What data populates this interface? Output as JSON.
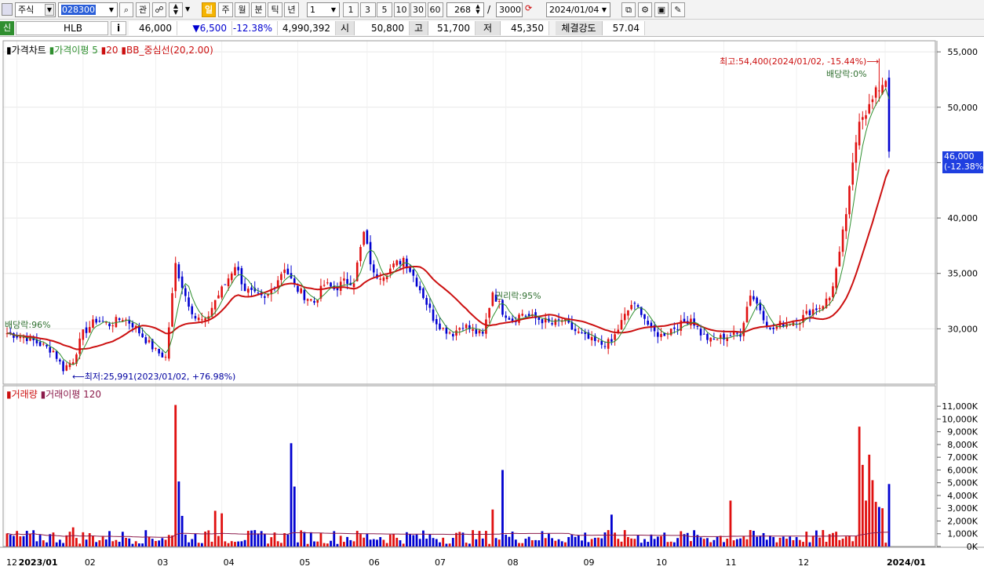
{
  "toolbar": {
    "market": "주식",
    "code": "028300",
    "search_icon": "search-icon",
    "interest_label": "관",
    "period_active": "일",
    "periods": [
      "주",
      "월",
      "분",
      "틱",
      "년"
    ],
    "interval_value": "1",
    "interval_presets": [
      "1",
      "3",
      "5",
      "10",
      "30",
      "60"
    ],
    "count_value": "268",
    "count_total": "3000",
    "date_value": "2024/01/04"
  },
  "infobar": {
    "flag": "신",
    "name": "HLB",
    "info_button": "i",
    "price": "46,000",
    "change": "▼6,500",
    "change_pct": "-12.38%",
    "volume": "4,990,392",
    "open_label": "시",
    "open": "50,800",
    "high_label": "고",
    "high": "51,700",
    "low_label": "저",
    "low": "45,350",
    "strength_label": "체결강도",
    "strength": "57.04"
  },
  "price_panel": {
    "legend_chart": "가격차트",
    "legend_ma": "가격이평 5",
    "legend_ma20": "20",
    "legend_bb": "BB_중심선(20,2.00)",
    "annotation_high": "최고:54,400(2024/01/02, -15.44%)",
    "annotation_low": "최저:25,991(2023/01/02, +76.98%)",
    "annotation_div1": "배당락:96%",
    "annotation_rights": "권리락:95%",
    "annotation_div2": "배당락:0%",
    "current_price": "46,000",
    "current_pct": "(-12.38%)"
  },
  "volume_panel": {
    "legend_volume": "거래량",
    "legend_vol_ma": "거래이평 120"
  },
  "colors": {
    "up": "#e01010",
    "down": "#0000d0",
    "ma5": "#2f8f2f",
    "bb_mid": "#cc1010",
    "vol_ma": "#8b1a4a"
  },
  "chart_data": {
    "type": "candlestick",
    "x_ticks": [
      "12",
      "2023/01",
      "02",
      "03",
      "04",
      "05",
      "06",
      "07",
      "08",
      "09",
      "10",
      "11",
      "12",
      "2024/01"
    ],
    "price_ticks": [
      "55,000",
      "50,000",
      "45,000",
      "40,000",
      "35,000",
      "30,000"
    ],
    "volume_ticks": [
      "11,000K",
      "10,000K",
      "9,000K",
      "8,000K",
      "7,000K",
      "6,000K",
      "5,000K",
      "4,000K",
      "3,000K",
      "2,000K",
      "1,000K",
      "0K"
    ],
    "price_range": [
      25000,
      56000
    ],
    "volume_range_k": [
      0,
      11500
    ],
    "close_path": [
      [
        0,
        29600
      ],
      [
        6,
        29200
      ],
      [
        10,
        28600
      ],
      [
        14,
        28000
      ],
      [
        17,
        26400
      ],
      [
        20,
        27200
      ],
      [
        23,
        29600
      ],
      [
        27,
        30800
      ],
      [
        31,
        30400
      ],
      [
        35,
        31000
      ],
      [
        38,
        30400
      ],
      [
        42,
        29000
      ],
      [
        45,
        28000
      ],
      [
        48,
        27400
      ],
      [
        51,
        35800
      ],
      [
        54,
        33000
      ],
      [
        57,
        31000
      ],
      [
        60,
        30600
      ],
      [
        63,
        32600
      ],
      [
        66,
        34000
      ],
      [
        69,
        35800
      ],
      [
        72,
        33600
      ],
      [
        75,
        33000
      ],
      [
        78,
        32600
      ],
      [
        81,
        34000
      ],
      [
        84,
        35600
      ],
      [
        87,
        33800
      ],
      [
        90,
        33000
      ],
      [
        93,
        32400
      ],
      [
        96,
        34000
      ],
      [
        99,
        33600
      ],
      [
        102,
        34200
      ],
      [
        105,
        34400
      ],
      [
        108,
        38600
      ],
      [
        111,
        34800
      ],
      [
        114,
        35000
      ],
      [
        117,
        35600
      ],
      [
        120,
        36400
      ],
      [
        123,
        34800
      ],
      [
        126,
        33000
      ],
      [
        129,
        31000
      ],
      [
        132,
        30000
      ],
      [
        135,
        29600
      ],
      [
        138,
        30400
      ],
      [
        141,
        29800
      ],
      [
        144,
        29400
      ],
      [
        147,
        33400
      ],
      [
        150,
        31600
      ],
      [
        153,
        30800
      ],
      [
        156,
        31400
      ],
      [
        159,
        31000
      ],
      [
        162,
        30800
      ],
      [
        165,
        30400
      ],
      [
        168,
        30800
      ],
      [
        171,
        30000
      ],
      [
        174,
        29400
      ],
      [
        177,
        28900
      ],
      [
        180,
        28600
      ],
      [
        183,
        28800
      ],
      [
        186,
        30600
      ],
      [
        189,
        32200
      ],
      [
        192,
        31600
      ],
      [
        195,
        29800
      ],
      [
        198,
        29400
      ],
      [
        201,
        30000
      ],
      [
        204,
        30400
      ],
      [
        207,
        31000
      ],
      [
        210,
        29600
      ],
      [
        213,
        28900
      ],
      [
        216,
        29200
      ],
      [
        219,
        29400
      ],
      [
        222,
        29600
      ],
      [
        225,
        33200
      ],
      [
        228,
        31800
      ],
      [
        231,
        29800
      ],
      [
        234,
        30400
      ],
      [
        237,
        30600
      ],
      [
        240,
        30800
      ],
      [
        243,
        31600
      ],
      [
        246,
        32000
      ],
      [
        249,
        32800
      ],
      [
        252,
        36600
      ],
      [
        255,
        42400
      ],
      [
        258,
        49200
      ],
      [
        261,
        50000
      ],
      [
        264,
        51800
      ],
      [
        266,
        52600
      ],
      [
        267,
        46000
      ]
    ],
    "volume_bars_k": [
      [
        20,
        1500
      ],
      [
        51,
        11100
      ],
      [
        52,
        5100
      ],
      [
        53,
        2400
      ],
      [
        63,
        2800
      ],
      [
        65,
        2600
      ],
      [
        86,
        8100
      ],
      [
        87,
        4700
      ],
      [
        147,
        2900
      ],
      [
        150,
        6000
      ],
      [
        183,
        2500
      ],
      [
        219,
        3600
      ],
      [
        258,
        9400
      ],
      [
        259,
        6400
      ],
      [
        260,
        3600
      ],
      [
        261,
        7200
      ],
      [
        262,
        5200
      ],
      [
        263,
        3500
      ],
      [
        264,
        3100
      ],
      [
        265,
        3000
      ],
      [
        267,
        4900
      ]
    ]
  }
}
